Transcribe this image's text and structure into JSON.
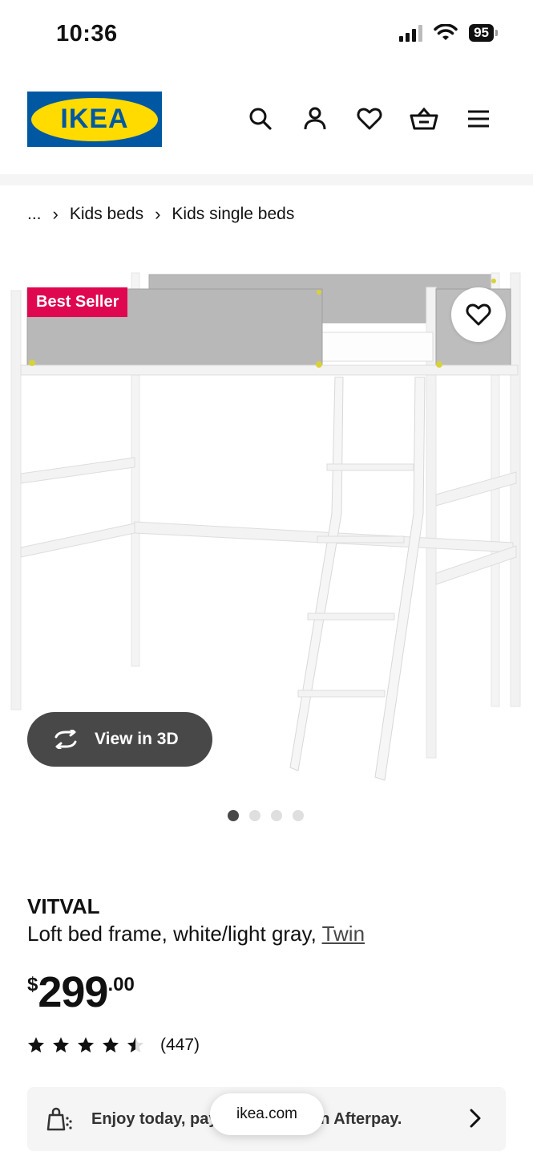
{
  "status_bar": {
    "time": "10:36",
    "battery": "95"
  },
  "header": {
    "logo_text": "IKEA",
    "icons": [
      "search-icon",
      "account-icon",
      "heart-icon",
      "cart-icon",
      "menu-icon"
    ]
  },
  "breadcrumb": {
    "ellipsis": "...",
    "items": [
      "Kids beds",
      "Kids single beds"
    ]
  },
  "gallery": {
    "badge": "Best Seller",
    "view3d_label": "View in 3D",
    "image_count": 4,
    "active_index": 0
  },
  "product": {
    "name": "VITVAL",
    "description": "Loft bed frame, white/light gray, ",
    "size_link": "Twin",
    "price_currency": "$",
    "price_whole": "299",
    "price_cents": ".00",
    "rating": 4.5,
    "rating_max": 5,
    "review_count": "(447)"
  },
  "afterpay": {
    "text": "Enjoy today, pay over time with Afterpay."
  },
  "browser": {
    "url": "ikea.com"
  },
  "colors": {
    "badge": "#e00751",
    "ikea_blue": "#0058a3",
    "ikea_yellow": "#ffdb00",
    "view3d_bg": "#484848"
  }
}
